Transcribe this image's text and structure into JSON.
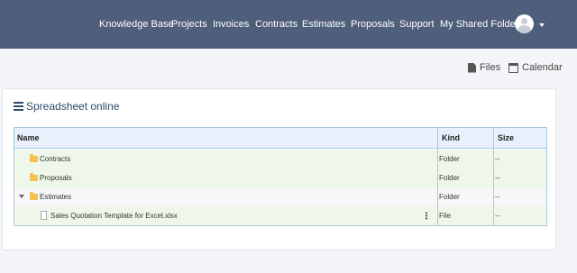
{
  "nav": {
    "items": [
      "Knowledge Base",
      "Projects",
      "Invoices",
      "Contracts",
      "Estimates",
      "Proposals",
      "Support",
      "My Shared Folder"
    ],
    "avatar_icon": "user-avatar",
    "caret_icon": "caret-down-icon"
  },
  "toolbar": {
    "files_label": "Files",
    "calendar_label": "Calendar"
  },
  "panel": {
    "title": "Spreadsheet online",
    "title_icon": "list-icon"
  },
  "grid": {
    "columns": [
      "Name",
      "Kind",
      "Size"
    ],
    "rows": [
      {
        "name": "Contracts",
        "kind": "Folder",
        "size": "--",
        "icon": "folder-icon"
      },
      {
        "name": "Proposals",
        "kind": "Folder",
        "size": "--",
        "icon": "folder-icon"
      },
      {
        "name": "Estimates",
        "kind": "Folder",
        "size": "--",
        "icon": "folder-icon",
        "expanded": true
      },
      {
        "name": "Sales Quotation Template for Excel.xlsx",
        "kind": "File",
        "size": "--",
        "icon": "document-icon"
      }
    ]
  },
  "colors": {
    "topbar": "#4f5e7b",
    "grid_border": "#aac8e0",
    "row_highlight": "#eef7ea",
    "title_text": "#2d4c6b"
  }
}
